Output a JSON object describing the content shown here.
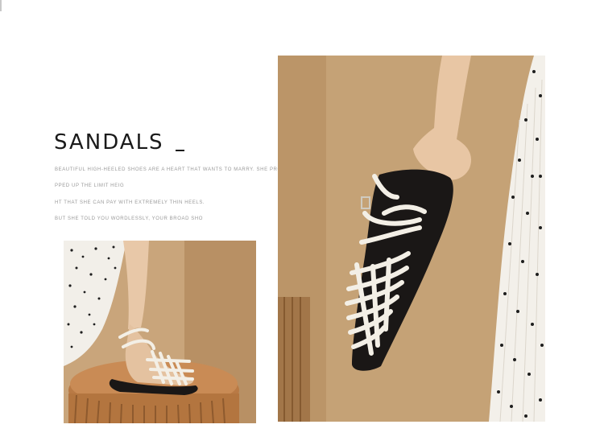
{
  "headline": {
    "title": "SANDALS"
  },
  "description": {
    "lines": [
      "BEAUTIFUL HIGH-HEELED SHOES ARE A HEART THAT WANTS TO MARRY. SHE PRO",
      "PPED UP THE LIMIT HEIG",
      "HT THAT SHE CAN PAY WITH EXTREMELY THIN HEELS.",
      "BUT SHE TOLD YOU WORDLESSLY, YOUR BROAD SHO"
    ]
  },
  "palette": {
    "background": "#ffffff",
    "text": "#1a1a1a",
    "muted_text": "#9a9a9a",
    "warm_wall": "#c8a47a",
    "strap_white": "#f3efe6",
    "sole_black": "#1a1716",
    "nail_polish": "#b4451e"
  },
  "photos": [
    {
      "subject": "foot-wearing-woven-sandal-on-pleated-stool-photo"
    },
    {
      "subject": "hand-holding-woven-strap-sandal-photo"
    }
  ]
}
